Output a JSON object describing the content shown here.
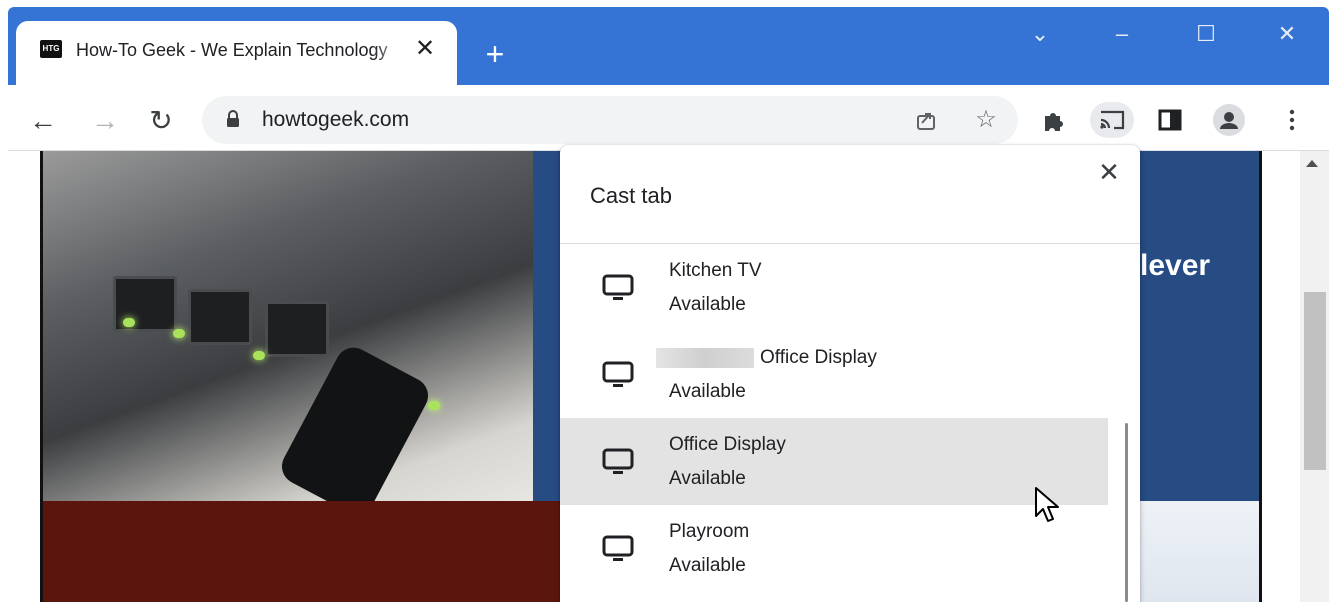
{
  "browser": {
    "tab": {
      "favicon_text": "HTG",
      "title": "How-To Geek - We Explain Technology",
      "close_icon": "close-icon"
    },
    "new_tab_icon": "plus-icon",
    "window_controls": [
      "tab-search-icon",
      "minimize-icon",
      "maximize-icon",
      "close-icon"
    ],
    "toolbar": {
      "url": "howtogeek.com",
      "icons": [
        "back-icon",
        "forward-icon",
        "reload-icon",
        "lock-icon",
        "share-icon",
        "star-icon",
        "puzzle-icon",
        "cast-icon",
        "side-panel-icon",
        "profile-icon",
        "menu-icon"
      ]
    }
  },
  "page": {
    "headline_fragment": "lever"
  },
  "cast_dialog": {
    "title": "Cast tab",
    "close_icon": "close-icon",
    "sinks": [
      {
        "name": "Kitchen TV",
        "status": "Available",
        "redacted_prefix": false,
        "highlighted": false
      },
      {
        "name": "Office Display",
        "status": "Available",
        "redacted_prefix": true,
        "highlighted": false
      },
      {
        "name": "Office Display",
        "status": "Available",
        "redacted_prefix": false,
        "highlighted": true
      },
      {
        "name": "Playroom",
        "status": "Available",
        "redacted_prefix": false,
        "highlighted": false
      }
    ]
  },
  "colors": {
    "titlebar": "#3574d4",
    "highlight_row": "#e3e3e3",
    "page_accent_blue": "#274b83",
    "page_accent_red": "#5c150c"
  }
}
